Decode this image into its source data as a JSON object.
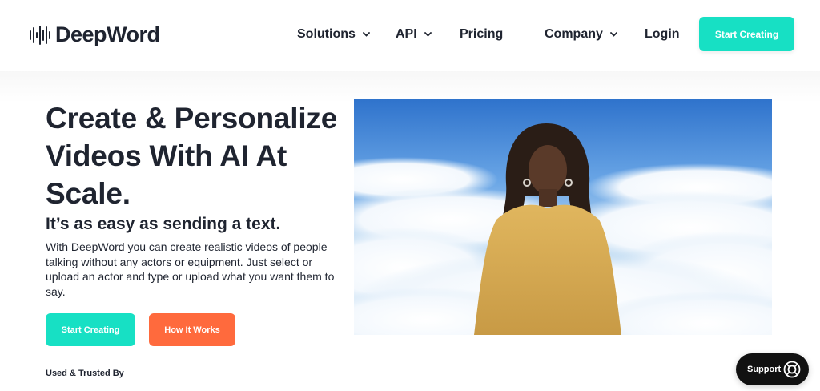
{
  "brand": {
    "name": "DeepWord"
  },
  "nav": {
    "items": [
      {
        "label": "Solutions"
      },
      {
        "label": "API"
      },
      {
        "label": "Pricing"
      },
      {
        "label": "Company"
      },
      {
        "label": "Login"
      }
    ],
    "cta_label": "Start Creating"
  },
  "hero": {
    "title": "Create & Personalize Videos With AI At Scale.",
    "subtitle": "It’s as easy as sending a text.",
    "description": "With DeepWord you can create realistic videos of people talking without any actors or equipment. Just select or upload an actor and type or upload what you want them to say.",
    "primary_button": "Start Creating",
    "secondary_button": "How It Works",
    "trusted_label": "Used & Trusted By"
  },
  "support": {
    "label": "Support"
  },
  "icons": {
    "logo": "audio-waveform-icon",
    "dropdown": "chevron-down-icon",
    "support": "lifebuoy-icon"
  },
  "colors": {
    "accent": "#17e0c4",
    "secondary": "#ff6a3d",
    "text": "#1f2430"
  }
}
